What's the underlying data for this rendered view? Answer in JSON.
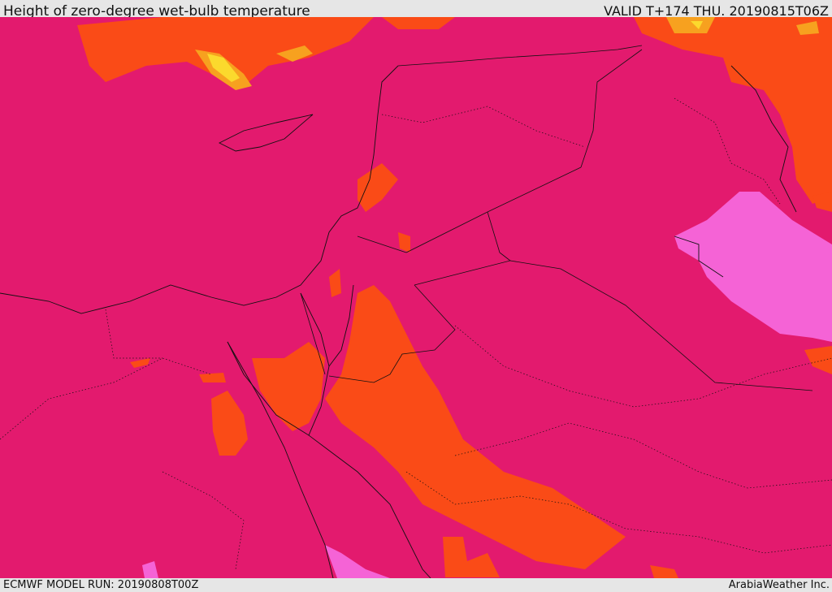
{
  "header": {
    "title": "Height of zero-degree wet-bulb temperature",
    "valid": "VALID T+174 THU. 20190815T06Z"
  },
  "footer": {
    "model_run": "ECMWF MODEL RUN: 20190808T00Z",
    "credit": "ArabiaWeather Inc."
  },
  "colors": {
    "base": "#e31a6e",
    "orange": "#fa4b17",
    "light_orange": "#f7a11f",
    "yellow": "#fbd92d",
    "pink": "#f563d6",
    "border": "#111111"
  }
}
